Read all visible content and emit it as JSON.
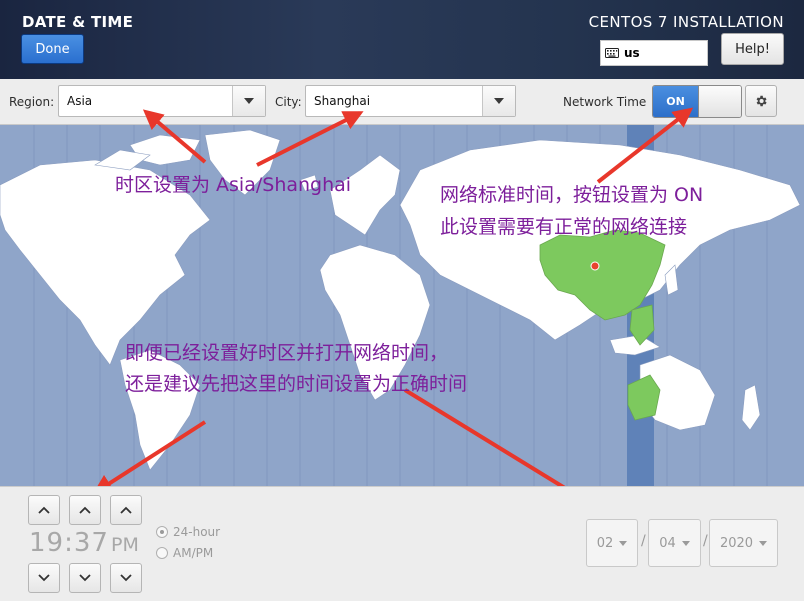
{
  "header": {
    "title": "DATE & TIME",
    "install_title": "CENTOS 7 INSTALLATION",
    "done_label": "Done",
    "keyboard_layout": "us",
    "help_label": "Help!"
  },
  "toolbar": {
    "region_label": "Region:",
    "region_value": "Asia",
    "city_label": "City:",
    "city_value": "Shanghai",
    "network_time_label": "Network Time",
    "network_time_state": "ON"
  },
  "annotations": {
    "timezone_note": "时区设置为 Asia/Shanghai",
    "network_note_line1": "网络标准时间，按钮设置为 ON",
    "network_note_line2": "此设置需要有正常的网络连接",
    "time_note_line1": "即便已经设置好时区并打开网络时间，",
    "time_note_line2": "还是建议先把这里的时间设置为正确时间"
  },
  "time": {
    "hours": "19",
    "separator": ":",
    "minutes": "37",
    "ampm": "PM",
    "format_24": "24-hour",
    "format_ampm": "AM/PM",
    "selected_format": "24-hour"
  },
  "date": {
    "month": "02",
    "day": "04",
    "year": "2020",
    "separator": "/"
  },
  "colors": {
    "header_bg": "#22304c",
    "accent_blue": "#2d6fc9",
    "map_ocean": "#8fa5c9",
    "land": "#ffffff",
    "selected_zone": "#7dc95e",
    "timezone_band": "#5f82b8",
    "annotation_text": "#7d1f9b",
    "arrow_red": "#e8372b"
  }
}
